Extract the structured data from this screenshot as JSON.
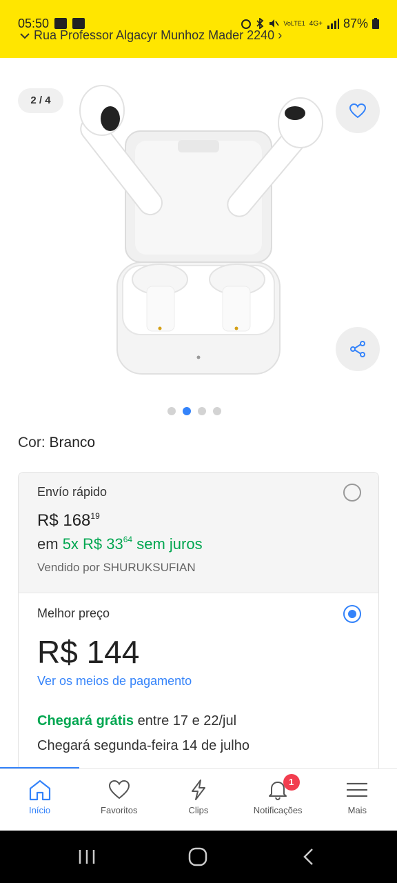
{
  "status_bar": {
    "time": "05:50",
    "net_top": "VoLTE1",
    "net_4g": "4G+",
    "battery": "87%"
  },
  "address": "Rua Professor Algacyr Munhoz Mader 2240",
  "image_counter": "2 / 4",
  "gallery": {
    "count": 4,
    "active_index": 1
  },
  "color": {
    "label": "Cor:",
    "value": "Branco"
  },
  "options": {
    "fast": {
      "title": "Envío rápido",
      "currency": "R$",
      "price_int": "168",
      "price_cents": "19",
      "inst_prefix": "em",
      "inst_amount_int": "5x R$ 33",
      "inst_amount_cents": "64",
      "inst_suffix": "sem juros",
      "seller": "Vendido por SHURUKSUFIAN",
      "selected": false
    },
    "best": {
      "title": "Melhor preço",
      "price": "R$ 144",
      "payment_link": "Ver os meios de pagamento",
      "ship_green": "Chegará grátis",
      "ship_rest": "entre 17 e 22/jul",
      "ship_line2": "Chegará segunda-feira 14 de julho",
      "selected": true
    }
  },
  "nav": {
    "items": [
      {
        "label": "Início",
        "icon": "home-icon",
        "active": true
      },
      {
        "label": "Favoritos",
        "icon": "heart-icon"
      },
      {
        "label": "Clips",
        "icon": "bolt-icon"
      },
      {
        "label": "Notificações",
        "icon": "bell-icon",
        "badge": "1"
      },
      {
        "label": "Mais",
        "icon": "menu-icon"
      }
    ]
  },
  "colors": {
    "brand_yellow": "#FFE600",
    "accent_blue": "#3483FA",
    "green": "#00A650",
    "badge_red": "#F23D4F"
  }
}
